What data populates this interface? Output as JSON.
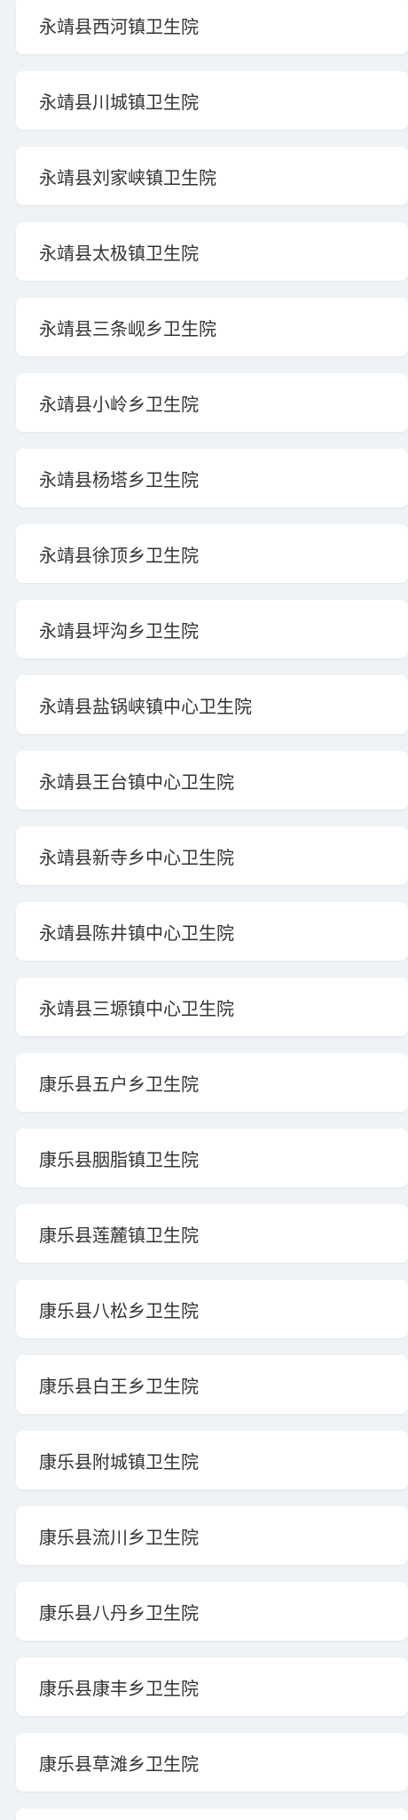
{
  "hospitals": {
    "items": [
      {
        "name": "永靖县西河镇卫生院"
      },
      {
        "name": "永靖县川城镇卫生院"
      },
      {
        "name": "永靖县刘家峡镇卫生院"
      },
      {
        "name": "永靖县太极镇卫生院"
      },
      {
        "name": "永靖县三条岘乡卫生院"
      },
      {
        "name": "永靖县小岭乡卫生院"
      },
      {
        "name": "永靖县杨塔乡卫生院"
      },
      {
        "name": "永靖县徐顶乡卫生院"
      },
      {
        "name": "永靖县坪沟乡卫生院"
      },
      {
        "name": "永靖县盐锅峡镇中心卫生院"
      },
      {
        "name": "永靖县王台镇中心卫生院"
      },
      {
        "name": "永靖县新寺乡中心卫生院"
      },
      {
        "name": "永靖县陈井镇中心卫生院"
      },
      {
        "name": "永靖县三塬镇中心卫生院"
      },
      {
        "name": "康乐县五户乡卫生院"
      },
      {
        "name": "康乐县胭脂镇卫生院"
      },
      {
        "name": "康乐县莲麓镇卫生院"
      },
      {
        "name": "康乐县八松乡卫生院"
      },
      {
        "name": "康乐县白王乡卫生院"
      },
      {
        "name": "康乐县附城镇卫生院"
      },
      {
        "name": "康乐县流川乡卫生院"
      },
      {
        "name": "康乐县八丹乡卫生院"
      },
      {
        "name": "康乐县康丰乡卫生院"
      },
      {
        "name": "康乐县草滩乡卫生院"
      },
      {
        "name": ""
      }
    ]
  }
}
